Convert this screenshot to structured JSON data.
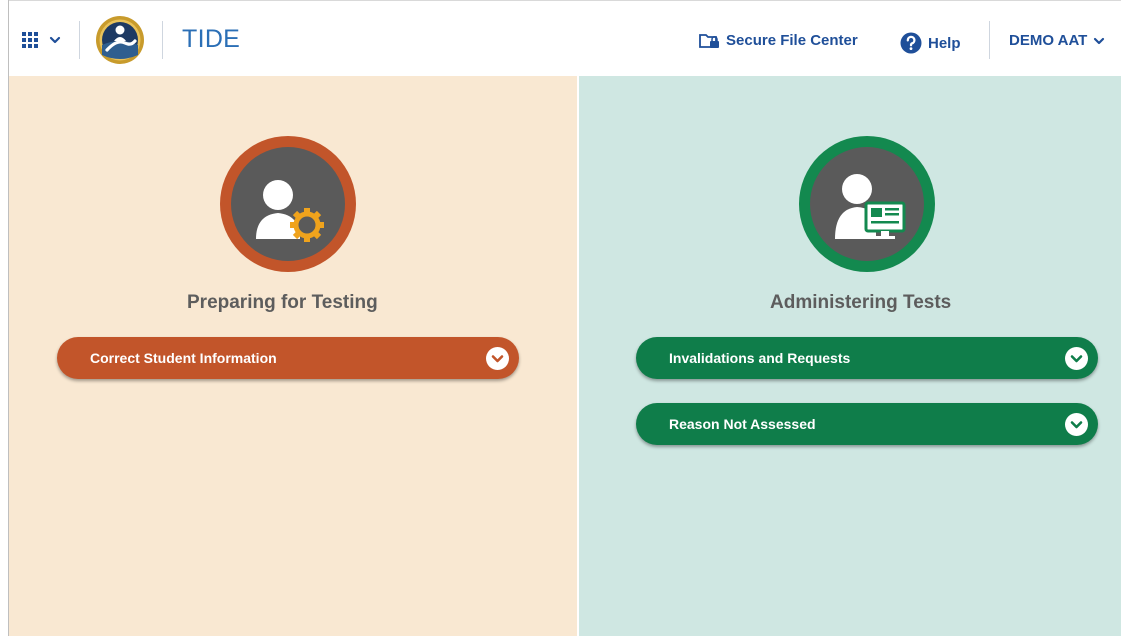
{
  "header": {
    "app_title": "TIDE",
    "secure_file_center": "Secure File Center",
    "help": "Help",
    "user_menu": "DEMO AAT"
  },
  "left_panel": {
    "title": "Preparing for Testing",
    "items": [
      {
        "label": "Correct Student Information"
      }
    ]
  },
  "right_panel": {
    "title": "Administering Tests",
    "items": [
      {
        "label": "Invalidations and Requests"
      },
      {
        "label": "Reason Not Assessed"
      }
    ]
  },
  "colors": {
    "left_bg": "#f9e8d2",
    "right_bg": "#cfe7e2",
    "orange_accent": "#c2552a",
    "green_accent": "#0f7d4a",
    "link_blue": "#1f4f99",
    "title_blue": "#2b6fb6"
  },
  "icons": {
    "apps": "grid-icon",
    "logo": "state-seal-logo",
    "secure_file": "folder-lock-icon",
    "help": "question-circle-icon",
    "user_chevron": "chevron-down-icon",
    "left_badge": "user-gear-icon",
    "right_badge": "user-monitor-icon"
  }
}
